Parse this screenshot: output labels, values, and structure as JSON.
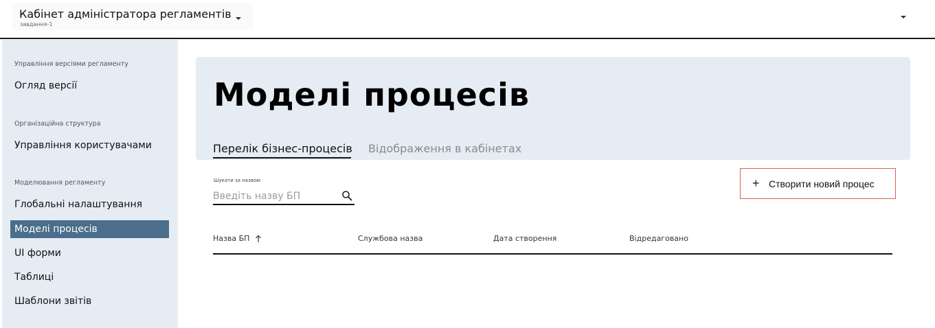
{
  "header": {
    "app_title": "Кабінет адміністратора регламентів",
    "app_subtitle": "завдання-1",
    "app_selector_icon": "chevron-down-icon",
    "user_menu_icon": "chevron-down-icon"
  },
  "sidebar": {
    "sections": [
      {
        "title": "Управління версіями регламенту",
        "items": [
          {
            "label": "Огляд версії"
          }
        ]
      },
      {
        "title": "Організаційна структура",
        "items": [
          {
            "label": "Управління користувачами"
          }
        ]
      },
      {
        "title": "Моделювання регламенту",
        "items": [
          {
            "label": "Глобальні налаштування"
          },
          {
            "label": "Моделі процесів",
            "active": true
          },
          {
            "label": "UI форми"
          },
          {
            "label": "Таблиці"
          },
          {
            "label": "Шаблони звітів"
          }
        ]
      }
    ]
  },
  "page": {
    "title": "Моделі процесів",
    "tabs": [
      {
        "label": "Перелік бізнес-процесів",
        "active": true
      },
      {
        "label": "Відображення в кабінетах",
        "active": false
      }
    ]
  },
  "search": {
    "label": "Шукати за назвою",
    "placeholder": "Введіть назву БП",
    "value": "",
    "icon": "search-icon"
  },
  "create_button": {
    "label": "Створити новий процес",
    "icon": "plus-icon"
  },
  "table": {
    "columns": [
      {
        "label": "Назва БП",
        "sorted": "ascending"
      },
      {
        "label": "Службова назва"
      },
      {
        "label": "Дата створення"
      },
      {
        "label": "Відредаговано"
      }
    ],
    "rows": []
  },
  "colors": {
    "sidebar_bg": "#e5ecf3",
    "active_item_bg": "#4a6e8c",
    "hero_bg": "#e5ecf3",
    "button_border": "#e05a5a"
  }
}
